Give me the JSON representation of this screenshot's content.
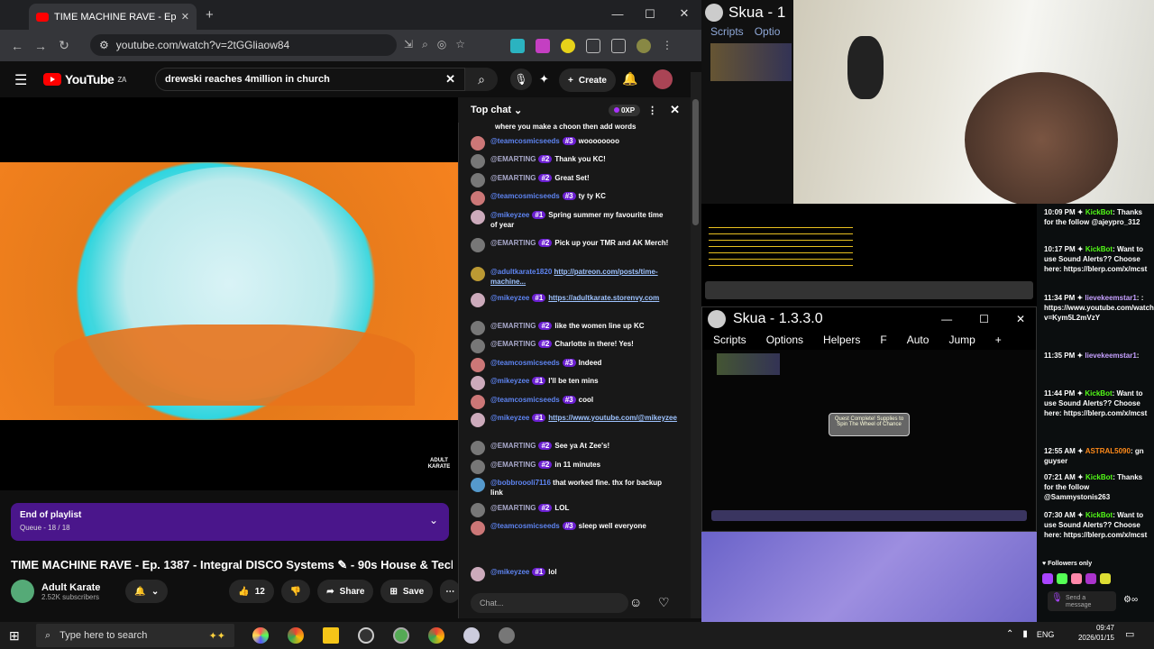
{
  "browser": {
    "tab_title": "TIME MACHINE RAVE - Ep.",
    "new_tab": "+",
    "url": "youtube.com/watch?v=2tGGliaow84"
  },
  "youtube": {
    "logo": "YouTube",
    "region": "ZA",
    "search_value": "drewski reaches 4million in church",
    "create_label": "Create",
    "video_watermark": "ADULT KARATE",
    "playlist_title": "End of playlist",
    "playlist_queue": "Queue - 18 / 18",
    "video_title": "TIME MACHINE RAVE - Ep. 1387 - Integral DISCO Systems ✎ - 90s House & Techno",
    "channel_name": "Adult Karate",
    "subscribers": "2.52K subscribers",
    "likes": "12",
    "share_label": "Share",
    "save_label": "Save"
  },
  "chat": {
    "header": "Top chat",
    "points": "0XP",
    "top_text": "where you make a choon then add words",
    "input_placeholder": "Chat...",
    "messages": [
      {
        "author": "@teamcosmicseeds",
        "badge": "#3",
        "text": "woooooooo",
        "color": "#c77"
      },
      {
        "author": "@EMARTING",
        "badge": "#2",
        "text": "Thank you KC!",
        "color": "#777"
      },
      {
        "author": "@EMARTING",
        "badge": "#2",
        "text": "Great Set!",
        "color": "#777"
      },
      {
        "author": "@teamcosmicseeds",
        "badge": "#3",
        "text": "ty ty KC",
        "color": "#c77"
      },
      {
        "author": "@mikeyzee",
        "badge": "#1",
        "text": "Spring summer my favourite time of year",
        "color": "#cab"
      },
      {
        "author": "@EMARTING",
        "badge": "#2",
        "text": "Pick up your TMR and AK Merch!",
        "color": "#777"
      },
      {
        "author": "@adultkarate1820",
        "badge": "",
        "text": "http://patreon.com/posts/time-machine...",
        "color": "#b93"
      },
      {
        "author": "@mikeyzee",
        "badge": "#1",
        "text": "https://adultkarate.storenvy.com",
        "color": "#cab"
      },
      {
        "author": "@EMARTING",
        "badge": "#2",
        "text": "like the women line up KC",
        "color": "#777"
      },
      {
        "author": "@EMARTING",
        "badge": "#2",
        "text": "Charlotte in there! Yes!",
        "color": "#777"
      },
      {
        "author": "@teamcosmicseeds",
        "badge": "#3",
        "text": "Indeed",
        "color": "#c77"
      },
      {
        "author": "@mikeyzee",
        "badge": "#1",
        "text": "I'll be ten mins",
        "color": "#cab"
      },
      {
        "author": "@teamcosmicseeds",
        "badge": "#3",
        "text": "cool",
        "color": "#c77"
      },
      {
        "author": "@mikeyzee",
        "badge": "#1",
        "text": "https://www.youtube.com/@mikeyzee",
        "color": "#cab"
      },
      {
        "author": "@EMARTING",
        "badge": "#2",
        "text": "See ya At Zee's!",
        "color": "#777"
      },
      {
        "author": "@EMARTING",
        "badge": "#2",
        "text": "in 11 minutes",
        "color": "#777"
      },
      {
        "author": "@bobbroooli7116",
        "badge": "",
        "text": "that worked fine. thx for backup link",
        "color": "#59c"
      },
      {
        "author": "@EMARTING",
        "badge": "#2",
        "text": "LOL",
        "color": "#777"
      },
      {
        "author": "@teamcosmicseeds",
        "badge": "#3",
        "text": "sleep well everyone",
        "color": "#c77"
      },
      {
        "author": "@mikeyzee",
        "badge": "#1",
        "text": "lol",
        "color": "#cab"
      }
    ]
  },
  "skua": {
    "title_top": "Skua - 1",
    "menu_top": [
      "Scripts",
      "Optio"
    ],
    "title": "Skua - 1.3.3.0",
    "menu": [
      "Scripts",
      "Options",
      "Helpers",
      "F",
      "Auto",
      "Jump",
      "+"
    ],
    "quest_popup": "Quest Complete! Supplies to Spin The Wheel of Chance"
  },
  "kick": {
    "messages": [
      {
        "time": "10:09 PM",
        "name": "KickBot",
        "cls": "",
        "text": "Thanks for the follow @ajeypro_312"
      },
      {
        "time": "10:17 PM",
        "name": "KickBot",
        "cls": "",
        "text": "Want to use Sound Alerts?? Choose here: https://blerp.com/x/mcst"
      },
      {
        "time": "11:34 PM",
        "name": "lievekeemstar1",
        "cls": "p",
        "text": ": https://www.youtube.com/watch?v=Kym5L2mVzY"
      },
      {
        "time": "11:35 PM",
        "name": "lievekeemstar1",
        "cls": "p",
        "text": ""
      },
      {
        "time": "11:44 PM",
        "name": "KickBot",
        "cls": "",
        "text": "Want to use Sound Alerts?? Choose here: https://blerp.com/x/mcst"
      },
      {
        "time": "12:55 AM",
        "name": "ASTRAL5090",
        "cls": "o",
        "text": "gn guyser"
      },
      {
        "time": "07:21 AM",
        "name": "KickBot",
        "cls": "",
        "text": "Thanks for the follow @Sammystonis263"
      },
      {
        "time": "07:30 AM",
        "name": "KickBot",
        "cls": "",
        "text": "Want to use Sound Alerts?? Choose here: https://blerp.com/x/mcst"
      }
    ],
    "followers_only": "Followers only",
    "send_label": "Send a message"
  },
  "taskbar": {
    "search_placeholder": "Type here to search",
    "lang": "ENG",
    "time": "09:47",
    "date": "2026/01/15"
  },
  "colors": {
    "youtube_red": "#ff0000",
    "playlist_purple": "#4a168b",
    "kick_green": "#53fc18"
  }
}
